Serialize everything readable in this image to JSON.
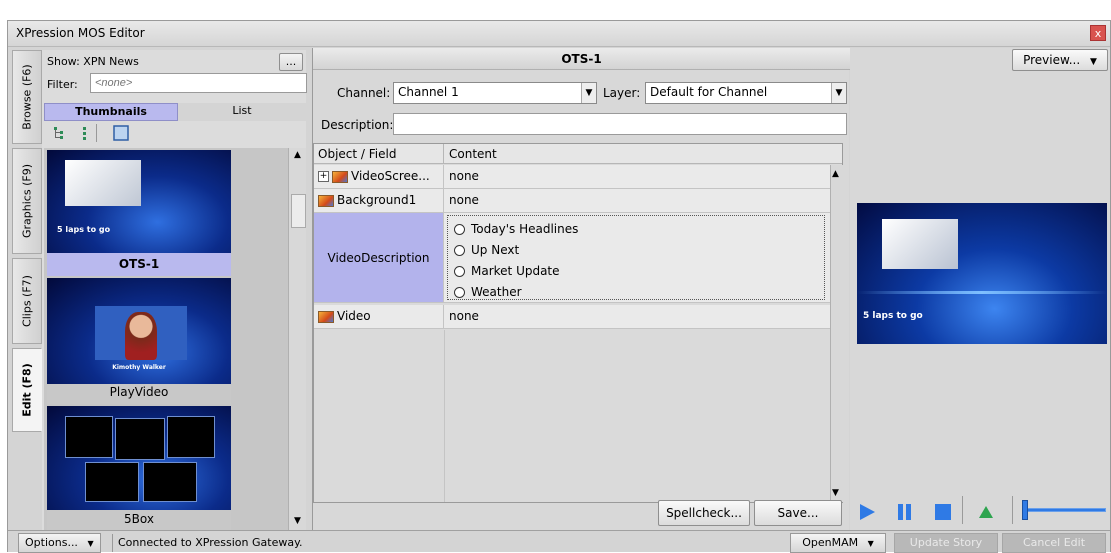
{
  "window": {
    "title": "XPression MOS Editor",
    "close_glyph": "x"
  },
  "side_tabs": [
    {
      "label": "Browse (F6)"
    },
    {
      "label": "Graphics (F9)"
    },
    {
      "label": "Clips (F7)"
    },
    {
      "label": "Edit (F8)"
    }
  ],
  "browse": {
    "show_label": "Show: XPN News",
    "show_button": "...",
    "filter_label": "Filter:",
    "filter_placeholder": "<none>",
    "tabs": {
      "thumbnails": "Thumbnails",
      "list": "List"
    },
    "thumbnails": [
      {
        "name": "OTS-1",
        "overlay_text": "5 laps to go"
      },
      {
        "name": "PlayVideo",
        "overlay_text": "Kimothy Walker"
      },
      {
        "name": "5Box",
        "overlay_text": ""
      }
    ]
  },
  "editor": {
    "template_title": "OTS-1",
    "channel_label": "Channel:",
    "channel_value": "Channel 1",
    "layer_label": "Layer:",
    "layer_value": "Default for Channel",
    "description_label": "Description:",
    "description_value": "",
    "grid": {
      "headers": {
        "field": "Object / Field",
        "content": "Content"
      },
      "rows": [
        {
          "field": "VideoScree...",
          "content": "none"
        },
        {
          "field": "Background1",
          "content": "none"
        },
        {
          "field": "VideoDescription",
          "options": [
            "Today's Headlines",
            "Up Next",
            "Market Update",
            "Weather"
          ]
        },
        {
          "field": "Video",
          "content": "none"
        }
      ]
    },
    "spellcheck_button": "Spellcheck...",
    "save_button": "Save..."
  },
  "preview": {
    "button": "Preview...",
    "overlay_text": "5 laps to go"
  },
  "status": {
    "options_button": "Options...",
    "message": "Connected to XPression Gateway.",
    "openmam_button": "OpenMAM",
    "update_story_button": "Update Story",
    "cancel_edit_button": "Cancel Edit"
  },
  "colors": {
    "selected_tab": "#b9b9ee",
    "selected_row": "#b3b3ec",
    "play_blue": "#2f7ae5",
    "green_arrow": "#2ea44f",
    "close_red": "#d9534f"
  }
}
